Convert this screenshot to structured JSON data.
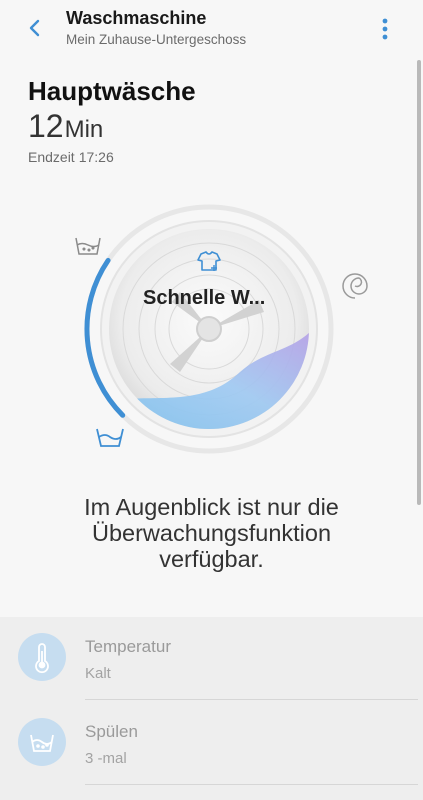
{
  "header": {
    "title": "Waschmaschine",
    "subtitle": "Mein Zuhause-Untergeschoss"
  },
  "status": {
    "program": "Hauptwäsche",
    "remaining_value": "12",
    "remaining_unit": "Min",
    "end_label": "Endzeit",
    "end_time": "17:26"
  },
  "dial": {
    "course_name": "Schnelle W...",
    "progress": 0.22,
    "stage_icons": [
      "wash-basin-icon",
      "spin-icon",
      "rinse-basin-icon"
    ]
  },
  "notice": {
    "line1": "Im Augenblick ist nur die",
    "line2": "Überwachungsfunktion",
    "line3": "verfügbar."
  },
  "options": [
    {
      "label": "Temperatur",
      "value": "Kalt",
      "icon": "thermometer-icon"
    },
    {
      "label": "Spülen",
      "value": "3 -mal",
      "icon": "rinse-icon"
    }
  ],
  "colors": {
    "accent": "#3f8fd4",
    "icon_circle": "#c6ddf0",
    "background": "#f7f7f7"
  }
}
